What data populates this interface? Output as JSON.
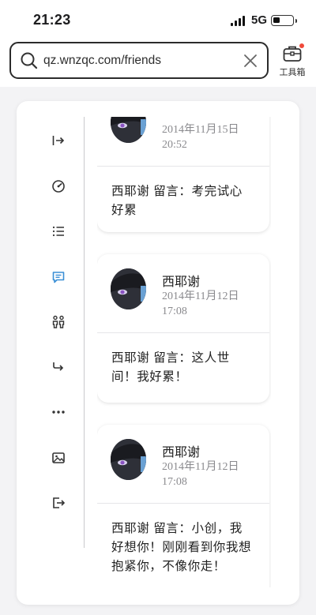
{
  "status_bar": {
    "time": "21:23",
    "network": "5G",
    "battery_level": 0.35
  },
  "browser": {
    "url": "qz.wnzqc.com/friends",
    "toolbox_label": "工具箱",
    "icons": [
      "search-icon",
      "clear-icon",
      "toolbox-icon"
    ]
  },
  "sidebar": {
    "items": [
      {
        "icon": "sign-in-icon"
      },
      {
        "icon": "speed-gauge-icon"
      },
      {
        "icon": "list-icon"
      },
      {
        "icon": "message-icon",
        "active": true
      },
      {
        "icon": "friends-icon"
      },
      {
        "icon": "share-arrow-icon"
      },
      {
        "icon": "more-icon"
      },
      {
        "icon": "image-icon"
      },
      {
        "icon": "logout-icon"
      }
    ],
    "active_color": "#3a8fd6"
  },
  "messages": [
    {
      "author": "",
      "date": "2014年11月15日",
      "time": "20:52",
      "text": "西耶谢 留言：考完试心好累"
    },
    {
      "author": "西耶谢",
      "date": "2014年11月12日",
      "time": "17:08",
      "text": "西耶谢 留言：这人世间！我好累！"
    },
    {
      "author": "西耶谢",
      "date": "2014年11月12日",
      "time": "17:08",
      "text": "西耶谢 留言：小创，我好想你！刚刚看到你我想抱紧你，不像你走！"
    }
  ]
}
